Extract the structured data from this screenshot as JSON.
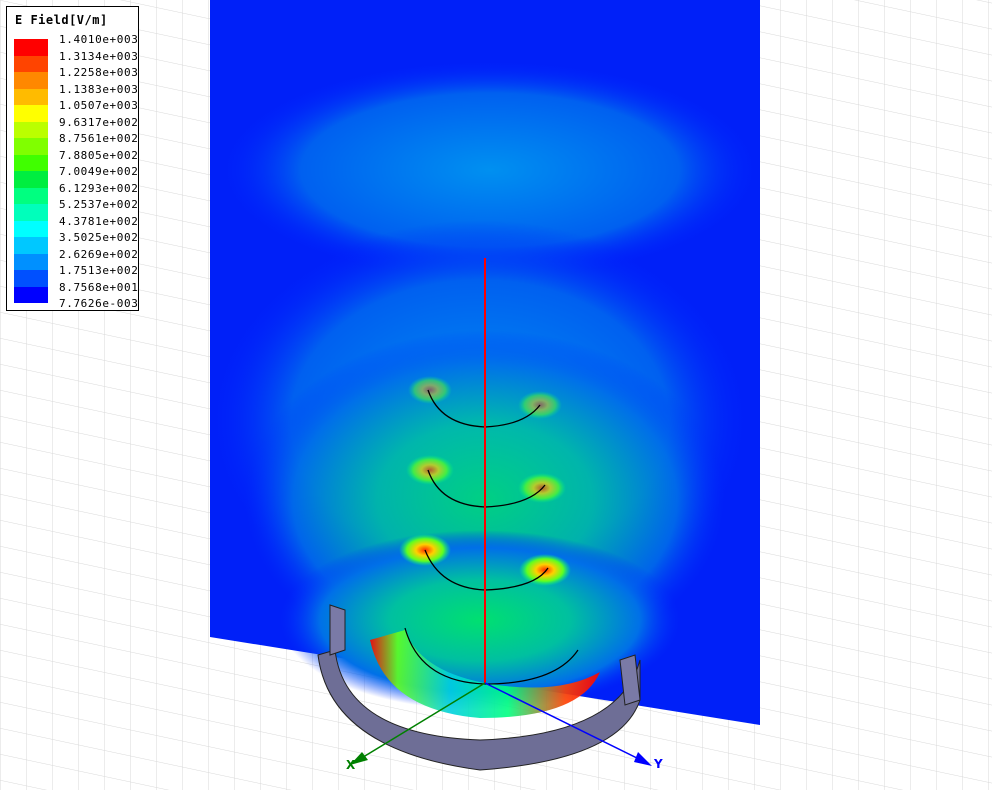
{
  "legend": {
    "title": "E Field[V/m]",
    "labels": [
      "1.4010e+003",
      "1.3134e+003",
      "1.2258e+003",
      "1.1383e+003",
      "1.0507e+003",
      "9.6317e+002",
      "8.7561e+002",
      "7.8805e+002",
      "7.0049e+002",
      "6.1293e+002",
      "5.2537e+002",
      "4.3781e+002",
      "3.5025e+002",
      "2.6269e+002",
      "1.7513e+002",
      "8.7568e+001",
      "7.7626e-003"
    ],
    "colors": [
      "#ff0000",
      "#ff4400",
      "#ff8800",
      "#ffbb00",
      "#ffff00",
      "#bbff00",
      "#80ff00",
      "#40ff00",
      "#00ee40",
      "#00ff80",
      "#00ffbb",
      "#00ffff",
      "#00c8ff",
      "#0090ff",
      "#0050ff",
      "#0000ff"
    ]
  },
  "axes": {
    "x_label": "X",
    "y_label": "Y",
    "x_color": "#008000",
    "y_color": "#0000ff",
    "z_color": "#ff0000"
  }
}
